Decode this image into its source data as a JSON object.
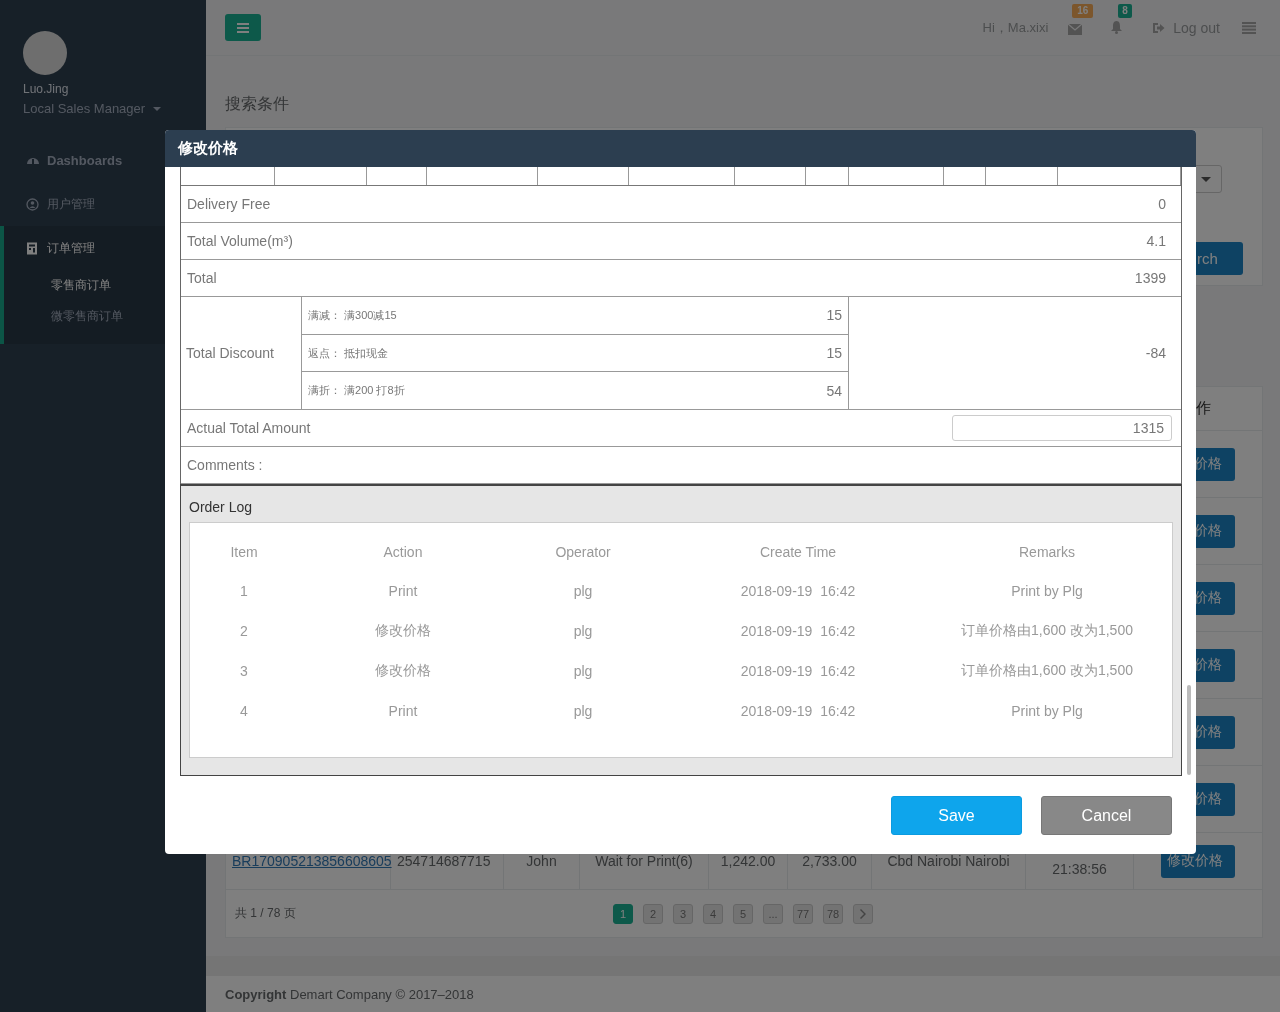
{
  "sidebar": {
    "user": {
      "name": "Luo.Jing",
      "role": "Local Sales Manager"
    },
    "nav": [
      {
        "label": "Dashboards",
        "selected": false
      },
      {
        "label": "用户管理",
        "selected": false
      },
      {
        "label": "订单管理",
        "selected": true,
        "children": [
          {
            "label": "零售商订单",
            "selected": true
          },
          {
            "label": "微零售商订单",
            "selected": false
          }
        ]
      }
    ]
  },
  "topbar": {
    "greeting": "Hi，Ma.xixi",
    "messages_badge": "16",
    "notifications_badge": "8",
    "logout": "Log out"
  },
  "page": {
    "section_title": "搜索条件",
    "search_button": "rch",
    "table": {
      "header_last": "作",
      "row_buttons": [
        "价格",
        "价格",
        "价格",
        "价格",
        "价格",
        "价格"
      ],
      "last_row": {
        "cells": [
          "BR170905213856608605",
          "254714687715",
          "John",
          "Wait for Print(6)",
          "1,242.00",
          "2,733.00",
          "Cbd Nairobi Nairobi",
          "21:38:56"
        ],
        "button": "修改价格"
      }
    },
    "pagination": {
      "summary": "共 1 / 78 页",
      "pages": [
        {
          "label": "1",
          "selected": true
        },
        {
          "label": "2",
          "selected": false
        },
        {
          "label": "3",
          "selected": false
        },
        {
          "label": "4",
          "selected": false
        },
        {
          "label": "5",
          "selected": false
        },
        {
          "label": "...",
          "selected": false
        },
        {
          "label": "77",
          "selected": false
        },
        {
          "label": "78",
          "selected": false
        }
      ]
    }
  },
  "footer": "**Copyright** Demart Company © 2017–2018",
  "modal": {
    "title": "修改价格",
    "summary_rows": [
      {
        "label": "Delivery Free",
        "value": "0"
      },
      {
        "label": "Total Volume(m³)",
        "value": "4.1"
      },
      {
        "label": "Total",
        "value": "1399"
      }
    ],
    "discount": {
      "label": "Total Discount",
      "items": [
        {
          "name": "满减： 满300减15",
          "value": "15"
        },
        {
          "name": "返点： 抵扣现金",
          "value": "15"
        },
        {
          "name": "满折： 满200 打8折",
          "value": "54"
        }
      ],
      "total": "-84"
    },
    "actual_total": {
      "label": "Actual Total Amount",
      "value": "1315"
    },
    "comments": {
      "label": "Comments :"
    },
    "order_log": {
      "title": "Order Log",
      "columns": [
        "Item",
        "Action",
        "Operator",
        "Create Time",
        "Remarks"
      ],
      "rows": [
        [
          "1",
          "Print",
          "plg",
          "2018-09-19  16:42",
          "Print by Plg"
        ],
        [
          "2",
          "修改价格",
          "plg",
          "2018-09-19  16:42",
          "订单价格由1,600 改为1,500"
        ],
        [
          "3",
          "修改价格",
          "plg",
          "2018-09-19  16:42",
          "订单价格由1,600 改为1,500"
        ],
        [
          "4",
          "Print",
          "plg",
          "2018-09-19  16:42",
          "Print by Plg"
        ]
      ]
    },
    "buttons": [
      {
        "label": "Save",
        "kind": "primary"
      },
      {
        "label": "Cancel",
        "kind": "secondary"
      }
    ]
  }
}
